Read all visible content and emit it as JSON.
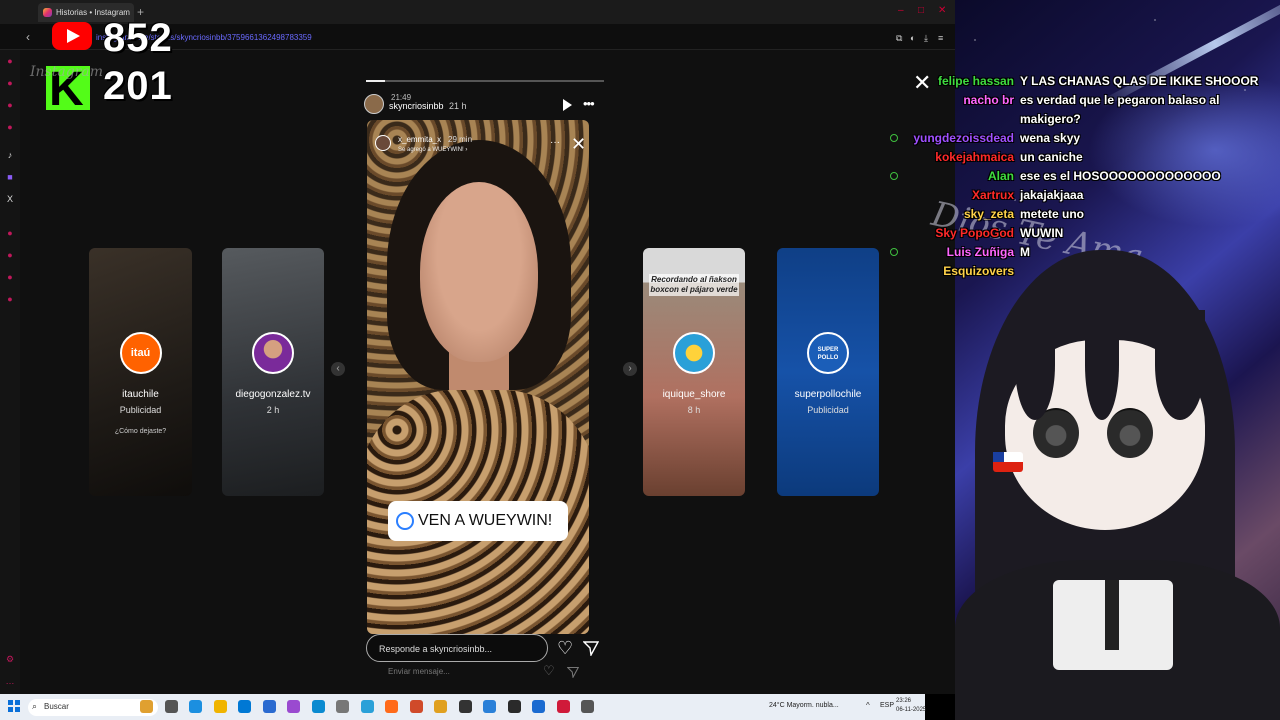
{
  "browser": {
    "tab_title": "Historias • Instagram",
    "address": "instagram.com/stories/skyncriosinbb/3759661362498783359",
    "window_controls": [
      "minimize-icon",
      "maximize-icon",
      "close-icon"
    ]
  },
  "counters": {
    "youtube": "852",
    "kick": "201"
  },
  "overlay_text": "Instagram",
  "story": {
    "clock": "21:49",
    "username": "skyncriosinbb",
    "time_ago": "21 h",
    "progress_fraction": 0.08,
    "inner_username": "x_emmita_x",
    "inner_time": "29 min",
    "inner_subtitle": "Se agregó a WUEYWIN! ›",
    "sticker_text": "VEN A WUEYWIN!",
    "reply_placeholder": "Responde a skyncriosinbb...",
    "reply_secondary": "Enviar mensaje..."
  },
  "cards": [
    {
      "name": "itauchile",
      "sub": "Publicidad",
      "extra": "¿Cómo dejaste?",
      "avatar_color": "#ff6200",
      "avatar_label": "itaú"
    },
    {
      "name": "diegogonzalez.tv",
      "sub": "2 h",
      "avatar_color": "#7a2a9a"
    },
    {
      "name": "iquique_shore",
      "sub": "8 h",
      "banner": "Recordando al ñakson boxcon el pájaro verde",
      "avatar_color": "#2aa0d8"
    },
    {
      "name": "superpollochile",
      "sub": "Publicidad",
      "avatar_color": "#1b5eb8",
      "avatar_label": "SUPER POLLO"
    }
  ],
  "chat": [
    {
      "user": "felipe hassan",
      "text": "Y LAS CHANAS QLAS DE IKIKE SHOOOR",
      "color": "#3fdc3f",
      "badge": false
    },
    {
      "user": "nacho br",
      "text": "es verdad que le pegaron balaso al",
      "color": "#ff66ff",
      "badge": false
    },
    {
      "user": "",
      "text": "makigero?",
      "color": "#ffffff",
      "badge": false
    },
    {
      "user": "yungdezoissdead",
      "text": "wena skyy",
      "color": "#a050ff",
      "badge": true
    },
    {
      "user": "kokejahmaica",
      "text": "un caniche",
      "color": "#ff2a2a",
      "badge": false
    },
    {
      "user": "Alan",
      "text": "ese es el HOSOOOOOOOOOOOOO",
      "color": "#3fdc3f",
      "badge": true
    },
    {
      "user": "Xartrux",
      "text": "jakajakjaaa",
      "color": "#ff2a2a",
      "badge": false
    },
    {
      "user": "sky_zeta",
      "text": "metete uno",
      "color": "#ffd24a",
      "badge": false
    },
    {
      "user": "Sky PopoGod",
      "text": "WUWIN",
      "color": "#ff2a2a",
      "badge": false
    },
    {
      "user": "Luis Zuñiga",
      "text": "M",
      "color": "#ff66ff",
      "badge": true
    },
    {
      "user": "Esquizovers",
      "text": "",
      "color": "#ffd24a",
      "badge": false
    }
  ],
  "stream_logo": "Dios Te Ama",
  "taskbar": {
    "search_placeholder": "Buscar",
    "weather": "24°C  Mayorm. nubla...",
    "lang": "ESP",
    "time": "23:26",
    "date": "06-11-2025",
    "app_icons": [
      "copilot-icon",
      "task-view-icon",
      "edge-icon",
      "explorer-icon",
      "store-icon",
      "vscode-icon",
      "paint-icon",
      "browser-icon",
      "settings-icon",
      "photos-icon",
      "firefox-icon",
      "app-icon",
      "chrome-icon",
      "obs-icon",
      "app-icon",
      "app-icon",
      "app-icon",
      "opera-icon",
      "app-icon"
    ]
  }
}
